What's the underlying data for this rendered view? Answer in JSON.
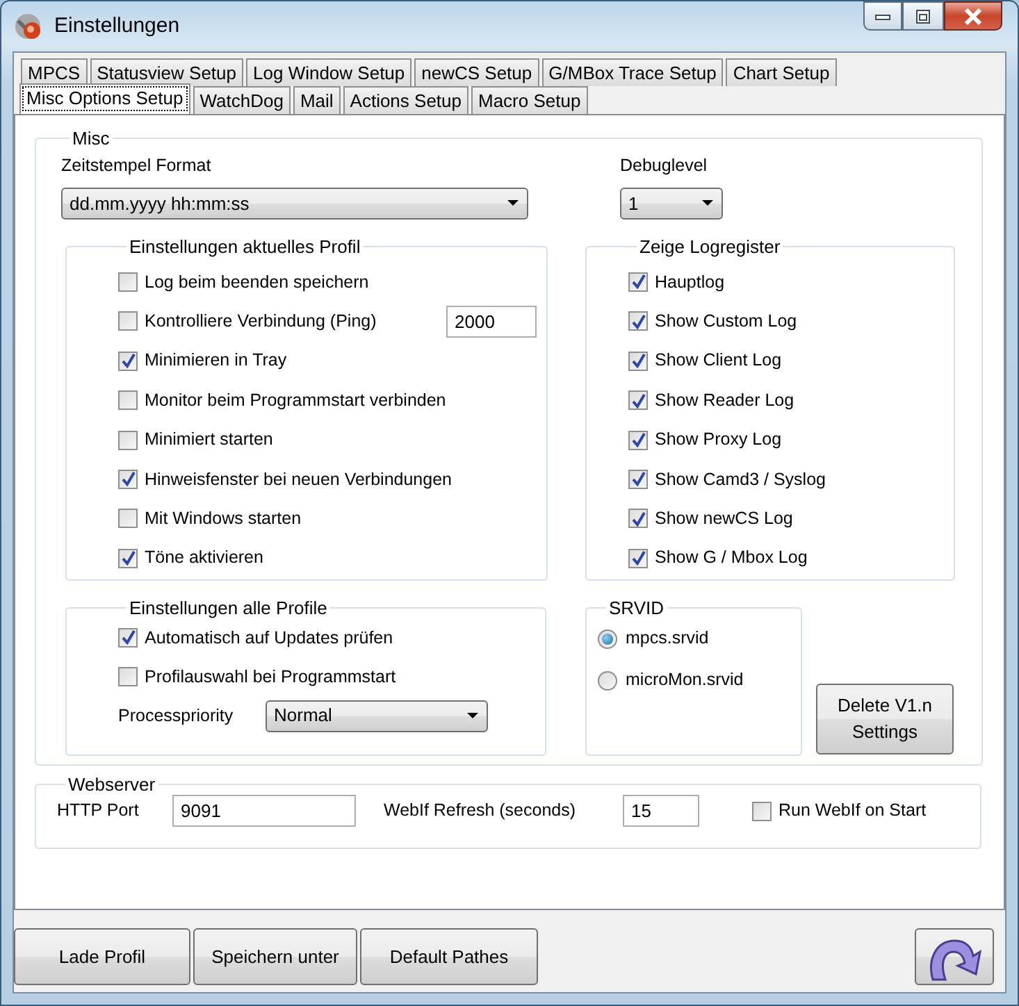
{
  "window": {
    "title": "Einstellungen"
  },
  "tab_rows": [
    {
      "tabs": [
        {
          "label": "MPCS",
          "selected": false
        },
        {
          "label": "Statusview Setup",
          "selected": false
        },
        {
          "label": "Log Window Setup",
          "selected": false
        },
        {
          "label": "newCS Setup",
          "selected": false
        },
        {
          "label": "G/MBox Trace Setup",
          "selected": false
        },
        {
          "label": "Chart Setup",
          "selected": false
        }
      ]
    },
    {
      "tabs": [
        {
          "label": "Misc Options Setup",
          "selected": true
        },
        {
          "label": "WatchDog",
          "selected": false
        },
        {
          "label": "Mail",
          "selected": false
        },
        {
          "label": "Actions Setup",
          "selected": false
        },
        {
          "label": "Macro Setup",
          "selected": false
        }
      ]
    }
  ],
  "misc": {
    "title": "Misc",
    "timestamp_format": {
      "label": "Zeitstempel Format",
      "value": "dd.mm.yyyy hh:mm:ss"
    },
    "debuglevel": {
      "label": "Debuglevel",
      "value": "1"
    },
    "current_profile": {
      "title": "Einstellungen aktuelles Profil",
      "options": [
        {
          "label": "Log beim beenden speichern",
          "checked": false
        },
        {
          "label": "Kontrolliere Verbindung (Ping)",
          "checked": false,
          "field_value": "2000"
        },
        {
          "label": "Minimieren in Tray",
          "checked": true
        },
        {
          "label": "Monitor beim Programmstart verbinden",
          "checked": false
        },
        {
          "label": "Minimiert starten",
          "checked": false
        },
        {
          "label": "Hinweisfenster bei neuen Verbindungen",
          "checked": true
        },
        {
          "label": "Mit Windows starten",
          "checked": false
        },
        {
          "label": "Töne aktivieren",
          "checked": true
        }
      ]
    },
    "log_registers": {
      "title": "Zeige Logregister",
      "options": [
        {
          "label": "Hauptlog",
          "checked": true
        },
        {
          "label": "Show Custom Log",
          "checked": true
        },
        {
          "label": "Show Client Log",
          "checked": true
        },
        {
          "label": "Show Reader Log",
          "checked": true
        },
        {
          "label": "Show Proxy Log",
          "checked": true
        },
        {
          "label": "Show Camd3 / Syslog",
          "checked": true
        },
        {
          "label": "Show newCS Log",
          "checked": true
        },
        {
          "label": "Show G / Mbox Log",
          "checked": true
        }
      ]
    },
    "all_profiles": {
      "title": "Einstellungen alle Profile",
      "options": [
        {
          "label": "Automatisch auf Updates prüfen",
          "checked": true
        },
        {
          "label": "Profilauswahl bei Programmstart",
          "checked": false
        }
      ],
      "priority": {
        "label": "Processpriority",
        "value": "Normal"
      }
    },
    "srvid": {
      "title": "SRVID",
      "options": [
        {
          "label": "mpcs.srvid",
          "selected": true
        },
        {
          "label": "microMon.srvid",
          "selected": false
        }
      ]
    },
    "delete_button": "Delete V1.n Settings"
  },
  "webserver": {
    "title": "Webserver",
    "http_port": {
      "label": "HTTP Port",
      "value": "9091"
    },
    "refresh": {
      "label": "WebIf Refresh (seconds)",
      "value": "15"
    },
    "run_on_start": {
      "label": "Run WebIf on Start",
      "checked": false
    }
  },
  "buttons": [
    "Lade Profil",
    "Speichern unter",
    "Default Pathes"
  ]
}
